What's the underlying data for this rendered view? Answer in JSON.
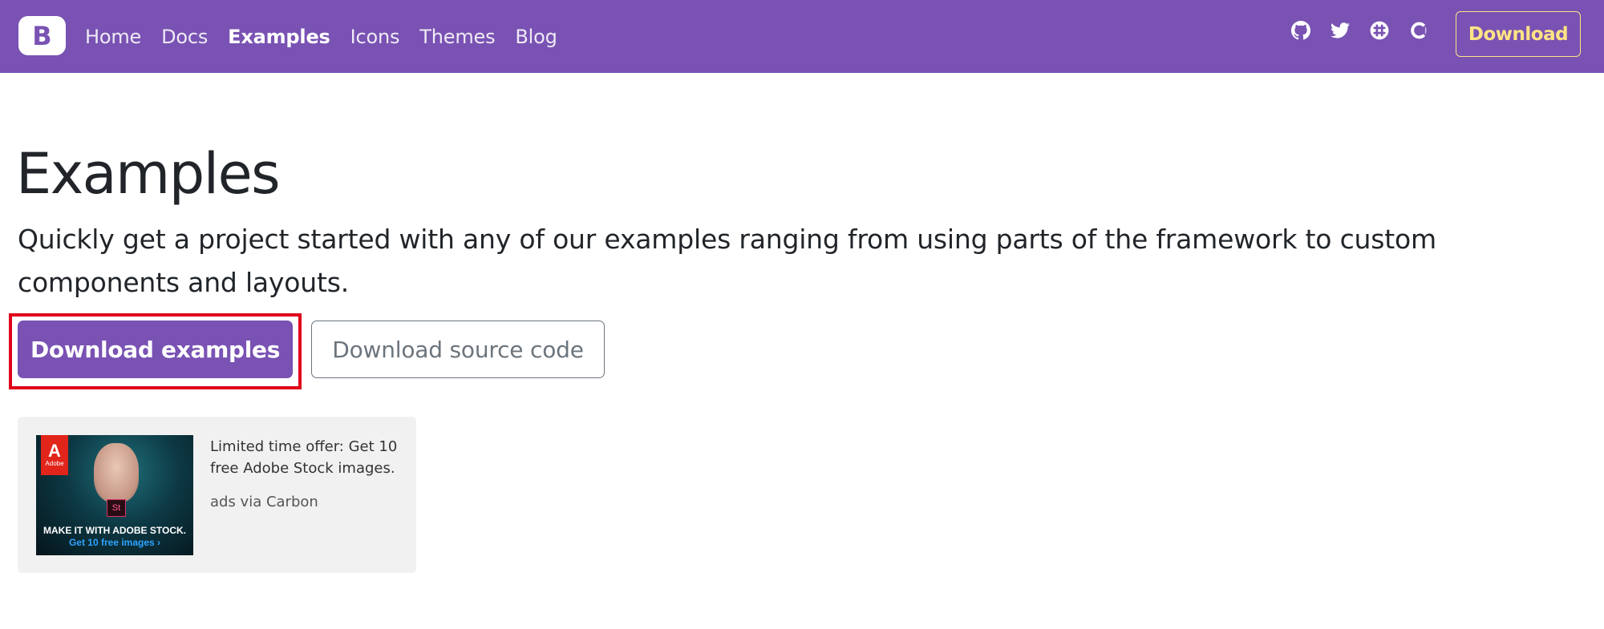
{
  "navbar": {
    "brand_letter": "B",
    "links": [
      {
        "label": "Home",
        "active": false
      },
      {
        "label": "Docs",
        "active": false
      },
      {
        "label": "Examples",
        "active": true
      },
      {
        "label": "Icons",
        "active": false
      },
      {
        "label": "Themes",
        "active": false
      },
      {
        "label": "Blog",
        "active": false
      }
    ],
    "icons": [
      "github-icon",
      "twitter-icon",
      "slack-icon",
      "opencollective-icon"
    ],
    "download_label": "Download",
    "colors": {
      "background": "#7952b3",
      "download_accent": "#ffe484"
    }
  },
  "main": {
    "title": "Examples",
    "lead": "Quickly get a project started with any of our examples ranging from using parts of the framework to custom components and layouts.",
    "primary_button": "Download examples",
    "secondary_button": "Download source code"
  },
  "ad": {
    "image_logo_letter": "A",
    "image_logo_text": "Adobe",
    "image_badge": "St",
    "image_caption_1": "MAKE IT WITH ADOBE STOCK.",
    "image_caption_2": "Get 10 free images ›",
    "text": "Limited time offer: Get 10 free Adobe Stock images.",
    "via": "ads via Carbon"
  }
}
